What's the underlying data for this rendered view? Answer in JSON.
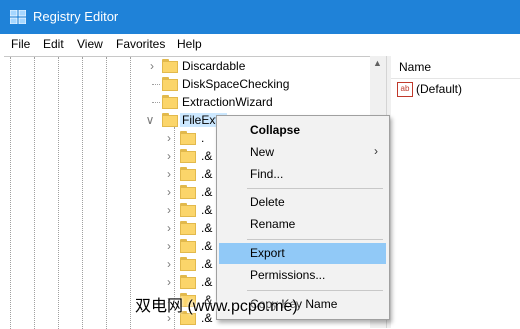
{
  "window": {
    "title": "Registry Editor",
    "title_bar_color": "#1f82d8"
  },
  "menubar": {
    "items": [
      "File",
      "Edit",
      "View",
      "Favorites",
      "Help"
    ]
  },
  "tree": {
    "items": [
      {
        "label": "Discardable",
        "expanded": false
      },
      {
        "label": "DiskSpaceChecking",
        "expanded": null
      },
      {
        "label": "ExtractionWizard",
        "expanded": null
      },
      {
        "label": "FileExts",
        "expanded": true,
        "selected": true
      },
      {
        "label": "."
      },
      {
        "label": ".&"
      },
      {
        "label": ".&"
      },
      {
        "label": ".&"
      },
      {
        "label": ".&"
      },
      {
        "label": ".&"
      },
      {
        "label": ".&"
      },
      {
        "label": ".&"
      },
      {
        "label": ".&"
      },
      {
        "label": ".&"
      },
      {
        "label": ".&"
      }
    ],
    "selected_highlight": "#cce8ff"
  },
  "details": {
    "column_name": "Name",
    "values": [
      {
        "icon": "string-value-icon",
        "icon_text": "ab",
        "name": "(Default)"
      }
    ]
  },
  "context_menu": {
    "items": [
      {
        "label": "Collapse",
        "bold": true
      },
      {
        "label": "New",
        "submenu": true
      },
      {
        "label": "Find..."
      },
      {
        "separator": true
      },
      {
        "label": "Delete"
      },
      {
        "label": "Rename"
      },
      {
        "separator": true
      },
      {
        "label": "Export",
        "highlighted": true
      },
      {
        "label": "Permissions..."
      },
      {
        "separator": true
      },
      {
        "label": "Copy Key Name"
      }
    ],
    "highlight_color": "#91c9f7"
  },
  "watermark": "双电网 (www.pcpo.me)"
}
